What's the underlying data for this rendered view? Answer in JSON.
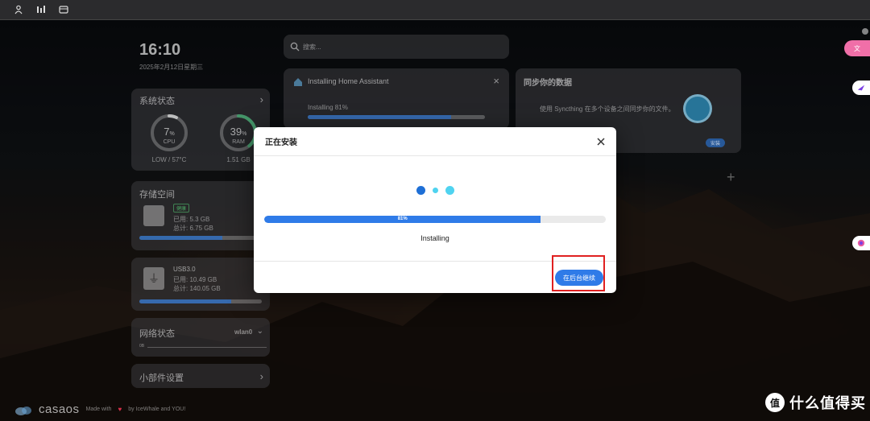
{
  "topbar": {
    "icons": [
      "user-icon",
      "grid-icon",
      "folder-icon"
    ]
  },
  "clock": {
    "time": "16:10",
    "date": "2025年2月12日星期三"
  },
  "system_status": {
    "title": "系统状态",
    "cpu": {
      "value": "7",
      "unit": "%",
      "label": "CPU",
      "detail": "LOW / 57°C",
      "percent": 7
    },
    "ram": {
      "value": "39",
      "unit": "%",
      "label": "RAM",
      "detail": "1.51 GB",
      "percent": 39
    }
  },
  "storage": {
    "title": "存储空间",
    "badge": "健康",
    "used": "已用: 5.3 GB",
    "total": "总计: 6.75 GB",
    "used_fraction": 0.68
  },
  "usb": {
    "title": "USB3.0",
    "used": "已用: 10.49 GB",
    "total": "总计: 140.05 GB",
    "used_fraction": 0.75
  },
  "network": {
    "title": "网络状态",
    "interface": "wlan0",
    "axis_label": "0B"
  },
  "widget_settings": {
    "title": "小部件设置"
  },
  "search": {
    "placeholder": "搜索..."
  },
  "install_card": {
    "title": "Installing Home Assistant",
    "progress_label": "Installing 81%",
    "progress": 0.81
  },
  "sync_card": {
    "title": "同步你的数据",
    "description": "使用 Syncthing 在多个设备之间同步你的文件。",
    "button": "安装"
  },
  "modal": {
    "title": "正在安装",
    "progress": 0.81,
    "progress_text": "81%",
    "status": "Installing",
    "continue_button": "在后台继续"
  },
  "footer": {
    "logo": "casaos",
    "made_with": "Made with",
    "by": "by IceWhale and YOU!"
  },
  "watermark": {
    "text": "什么值得买"
  },
  "colors": {
    "accent": "#2f7be8",
    "highlight": "#e02020",
    "dot_dark": "#1e6fd6",
    "dot_light": "#4fd3f0"
  }
}
